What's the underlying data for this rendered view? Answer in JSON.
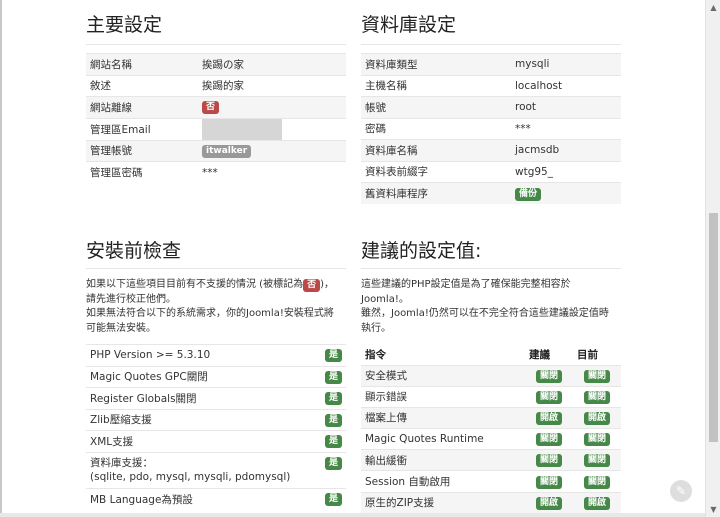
{
  "main_settings": {
    "title": "主要設定",
    "rows": [
      {
        "label": "網站名稱",
        "value": "挨踢の家"
      },
      {
        "label": "敘述",
        "value": "挨踢的家"
      },
      {
        "label": "網站離線",
        "badge": "否"
      },
      {
        "label": "管理區Email",
        "value": ""
      },
      {
        "label": "管理帳號",
        "badge": "itwalker"
      },
      {
        "label": "管理區密碼",
        "value": "***"
      }
    ]
  },
  "database_settings": {
    "title": "資料庫設定",
    "rows": [
      {
        "label": "資料庫類型",
        "value": "mysqli"
      },
      {
        "label": "主機名稱",
        "value": "localhost"
      },
      {
        "label": "帳號",
        "value": "root"
      },
      {
        "label": "密碼",
        "value": "***"
      },
      {
        "label": "資料庫名稱",
        "value": "jacmsdb"
      },
      {
        "label": "資料表前綴字",
        "value": "wtg95_"
      },
      {
        "label": "舊資料庫程序",
        "badge": "備份"
      }
    ]
  },
  "preinstall": {
    "title": "安裝前檢查",
    "intro_line1a": "如果以下這些項目目前有不支援的情況 (被標記為",
    "intro_badge": "否",
    "intro_line1b": ")，",
    "intro_line2": "請先進行校正他們。",
    "intro_line3": "如果無法符合以下的系統需求，你的Joomla!安裝程式將",
    "intro_line4": "可能無法安裝。",
    "checks": [
      {
        "label": "PHP Version >= 5.3.10",
        "status": "是"
      },
      {
        "label": "Magic Quotes GPC關閉",
        "status": "是"
      },
      {
        "label": "Register Globals關閉",
        "status": "是"
      },
      {
        "label": "Zlib壓縮支援",
        "status": "是"
      },
      {
        "label": "XML支援",
        "status": "是"
      },
      {
        "label": "資料庫支援：",
        "sub": "(sqlite, pdo, mysql, mysqli, pdomysql)",
        "status": "是"
      },
      {
        "label": "MB Language為預設",
        "status": "是"
      }
    ]
  },
  "recommended": {
    "title": "建議的設定值:",
    "intro_line1": "這些建議的PHP設定值是為了確保能完整相容於",
    "intro_line2": "Joomla!。",
    "intro_line3": "雖然，Joomla!仍然可以在不完全符合這些建議設定值時",
    "intro_line4": "執行。",
    "headers": {
      "directive": "指令",
      "recommended": "建議",
      "actual": "目前"
    },
    "rows": [
      {
        "label": "安全模式",
        "rec": "關閉",
        "cur": "關閉"
      },
      {
        "label": "顯示錯誤",
        "rec": "關閉",
        "cur": "關閉"
      },
      {
        "label": "檔案上傳",
        "rec": "開啟",
        "cur": "開啟"
      },
      {
        "label": "Magic Quotes Runtime",
        "rec": "關閉",
        "cur": "關閉"
      },
      {
        "label": "輸出緩衝",
        "rec": "關閉",
        "cur": "關閉"
      },
      {
        "label": "Session 自動啟用",
        "rec": "關閉",
        "cur": "關閉"
      },
      {
        "label": "原生的ZIP支援",
        "rec": "開啟",
        "cur": "開啟"
      }
    ]
  },
  "colors": {
    "red": "#b94a48",
    "green": "#468847",
    "gray": "#999999"
  },
  "icons": {
    "scroll_up": "chevron-up-icon",
    "scroll_down": "chevron-down-icon",
    "fab": "edit-icon"
  }
}
